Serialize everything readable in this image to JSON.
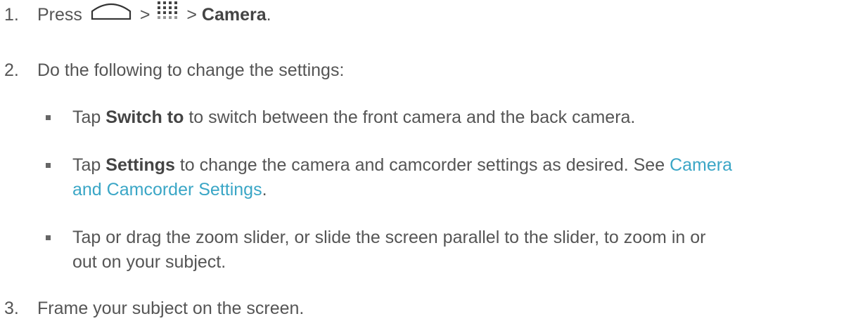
{
  "steps": [
    {
      "number": "1.",
      "press": "Press",
      "sep1": ">",
      "sep2": ">",
      "target": "Camera",
      "end": ".",
      "icons": [
        "home-icon",
        "apps-grid-icon"
      ]
    },
    {
      "number": "2.",
      "text": "Do the following to change the settings:"
    },
    {
      "number": "3.",
      "text": "Frame your subject on the screen."
    }
  ],
  "bullets": [
    {
      "pre": "Tap ",
      "bold": "Switch to",
      "post": " to switch between the front camera and the back camera."
    },
    {
      "pre": "Tap ",
      "bold": "Settings",
      "post": " to change the camera and camcorder settings as desired. See ",
      "link_line1": "Camera",
      "link_line2": "and Camcorder Settings",
      "end": "."
    },
    {
      "line1": "Tap or drag the zoom slider, or slide the screen parallel to the slider, to zoom in or",
      "line2": "out on your subject."
    }
  ],
  "colors": {
    "text": "#555555",
    "link": "#3aa6c6"
  }
}
